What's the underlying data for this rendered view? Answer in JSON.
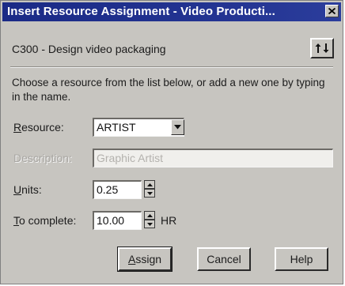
{
  "window": {
    "title": "Insert Resource Assignment - Video Producti...",
    "close_icon": "close-icon"
  },
  "task": {
    "label": "C300 - Design video packaging",
    "sort_icon": "sort-up-down-icon"
  },
  "instructions": "Choose a resource from the list below, or add a new one by typing in the name.",
  "fields": {
    "resource": {
      "label_ul": "R",
      "label_rest": "esource:",
      "value": "ARTIST"
    },
    "description": {
      "label": "Description:",
      "value": "Graphic Artist"
    },
    "units": {
      "label_ul": "U",
      "label_rest": "nits:",
      "value": "0.25"
    },
    "to_complete": {
      "label_ul": "T",
      "label_rest": "o complete:",
      "value": "10.00",
      "unit": "HR"
    }
  },
  "buttons": {
    "assign_ul": "A",
    "assign_rest": "ssign",
    "cancel": "Cancel",
    "help": "Help"
  },
  "colors": {
    "titlebar": "#1a2a86",
    "dialog_bg": "#c7c5c0"
  }
}
